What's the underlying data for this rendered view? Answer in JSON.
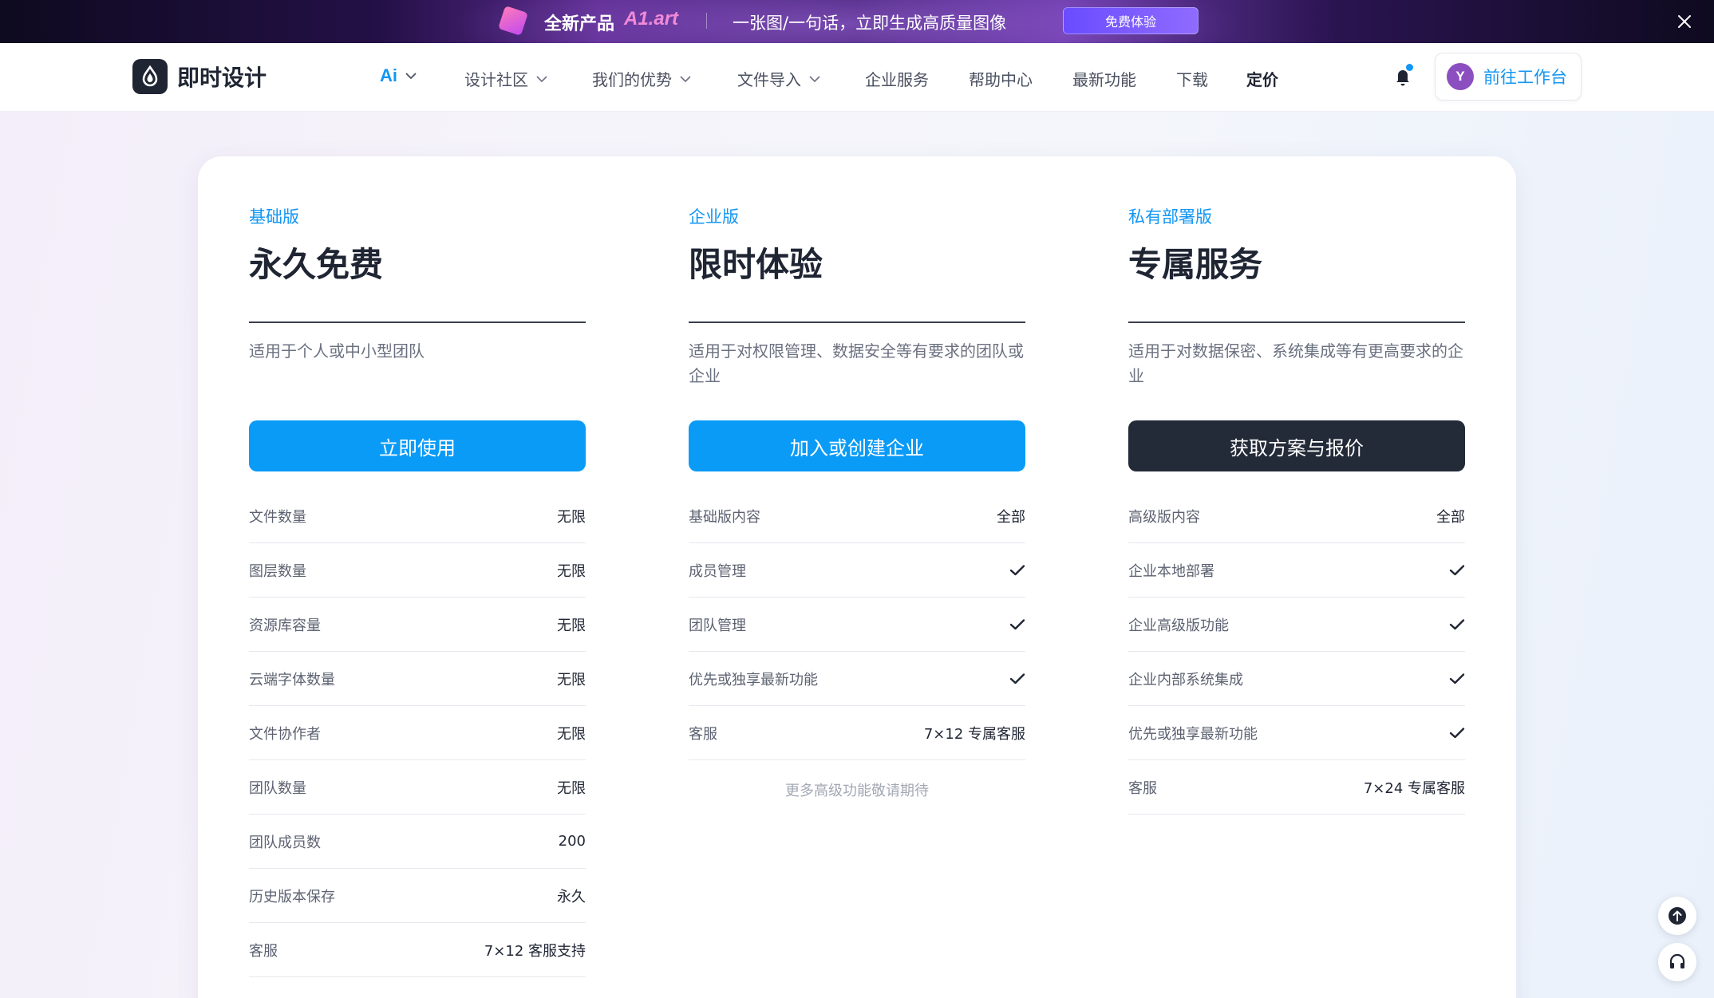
{
  "promo": {
    "title": "全新产品",
    "brand": "A1.art",
    "slogan": "一张图/一句话，立即生成高质量图像",
    "cta_label": "免费体验"
  },
  "header": {
    "brand_name": "即时设计",
    "nav": [
      {
        "label": "Ai",
        "has_dropdown": true
      },
      {
        "label": "设计社区",
        "has_dropdown": true
      },
      {
        "label": "我们的优势",
        "has_dropdown": true
      },
      {
        "label": "文件导入",
        "has_dropdown": true
      },
      {
        "label": "企业服务",
        "has_dropdown": false
      },
      {
        "label": "帮助中心",
        "has_dropdown": false
      },
      {
        "label": "最新功能",
        "has_dropdown": false
      },
      {
        "label": "下载",
        "has_dropdown": false
      },
      {
        "label": "定价",
        "has_dropdown": false,
        "current": true
      }
    ],
    "avatar_initial": "Y",
    "workspace_label": "前往工作台"
  },
  "plans": [
    {
      "tag": "基础版",
      "title": "永久免费",
      "description": "适用于个人或中小型团队",
      "button_label": "立即使用",
      "features": [
        {
          "label": "文件数量",
          "value": "无限"
        },
        {
          "label": "图层数量",
          "value": "无限"
        },
        {
          "label": "资源库容量",
          "value": "无限"
        },
        {
          "label": "云端字体数量",
          "value": "无限"
        },
        {
          "label": "文件协作者",
          "value": "无限"
        },
        {
          "label": "团队数量",
          "value": "无限"
        },
        {
          "label": "团队成员数",
          "value": "200"
        },
        {
          "label": "历史版本保存",
          "value": "永久"
        },
        {
          "label": "客服",
          "value": "7×12 客服支持"
        }
      ]
    },
    {
      "tag": "企业版",
      "title": "限时体验",
      "description": "适用于对权限管理、数据安全等有要求的团队或企业",
      "button_label": "加入或创建企业",
      "features": [
        {
          "label": "基础版内容",
          "value": "全部"
        },
        {
          "label": "成员管理",
          "check": true
        },
        {
          "label": "团队管理",
          "check": true
        },
        {
          "label": "优先或独享最新功能",
          "check": true
        },
        {
          "label": "客服",
          "value": "7×12 专属客服"
        }
      ],
      "note": "更多高级功能敬请期待"
    },
    {
      "tag": "私有部署版",
      "title": "专属服务",
      "description": "适用于对数据保密、系统集成等有更高要求的企业",
      "button_label": "获取方案与报价",
      "features": [
        {
          "label": "高级版内容",
          "value": "全部"
        },
        {
          "label": "企业本地部署",
          "check": true
        },
        {
          "label": "企业高级版功能",
          "check": true
        },
        {
          "label": "企业内部系统集成",
          "check": true
        },
        {
          "label": "优先或独享最新功能",
          "check": true
        },
        {
          "label": "客服",
          "value": "7×24 专属客服"
        }
      ]
    }
  ],
  "colors": {
    "accent": "#0a9bf7",
    "dark_button": "#232a38",
    "text_primary": "#1f2533"
  }
}
